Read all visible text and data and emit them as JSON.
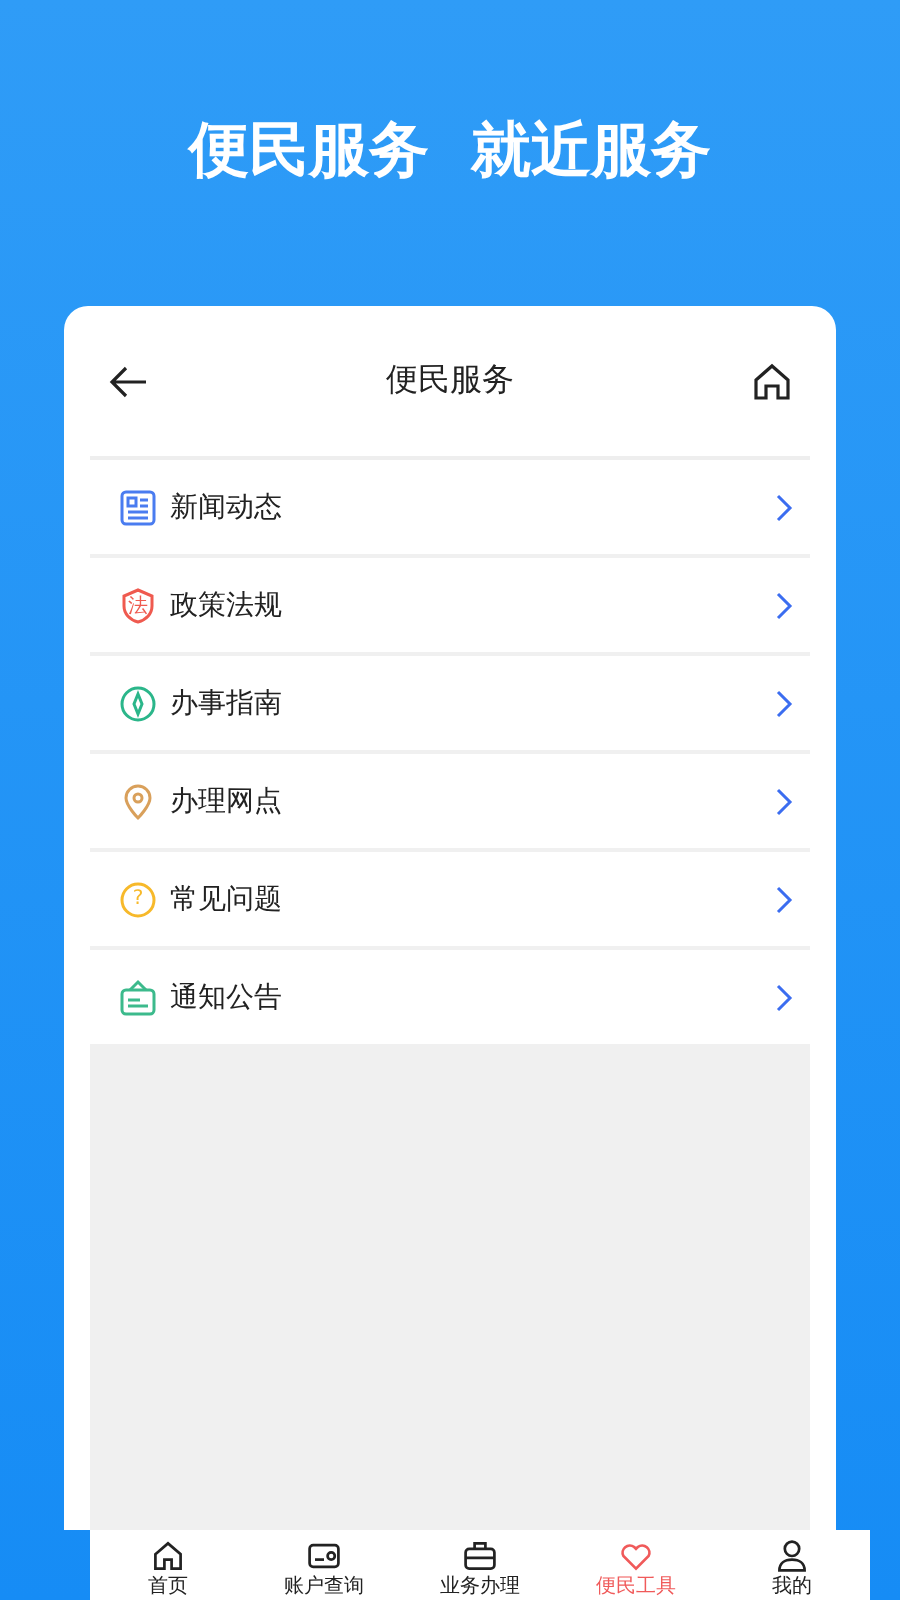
{
  "banner": {
    "title": "便民服务  就近服务"
  },
  "header": {
    "title": "便民服务"
  },
  "items": [
    {
      "kind": "news",
      "label": "新闻动态"
    },
    {
      "kind": "law",
      "label": "政策法规",
      "icon_text": "法"
    },
    {
      "kind": "guide",
      "label": "办事指南"
    },
    {
      "kind": "location",
      "label": "办理网点"
    },
    {
      "kind": "faq",
      "label": "常见问题",
      "icon_text": "?"
    },
    {
      "kind": "notice",
      "label": "通知公告"
    }
  ],
  "nav": [
    {
      "kind": "home",
      "label": "首页",
      "selected": false
    },
    {
      "kind": "account",
      "label": "账户查询",
      "selected": false
    },
    {
      "kind": "business",
      "label": "业务办理",
      "selected": false
    },
    {
      "kind": "tools",
      "label": "便民工具",
      "selected": true
    },
    {
      "kind": "me",
      "label": "我的",
      "selected": false
    }
  ]
}
